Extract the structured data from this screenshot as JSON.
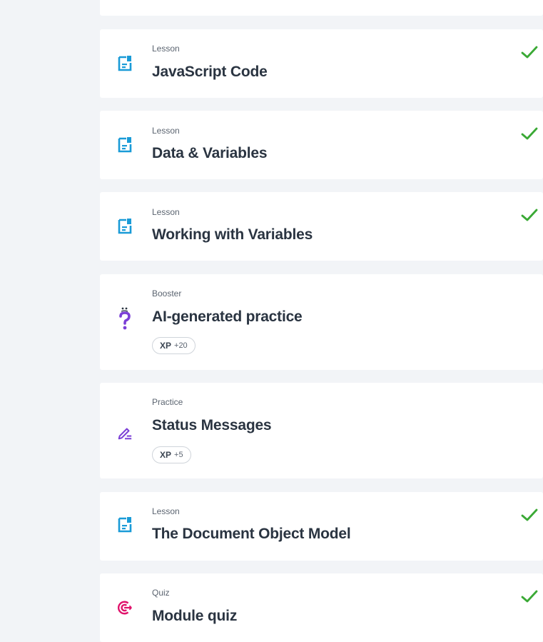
{
  "items": [
    {
      "kind": "Lesson",
      "title": "JavaScript Code",
      "icon": "lesson-document-icon",
      "completed": true
    },
    {
      "kind": "Lesson",
      "title": "Data & Variables",
      "icon": "lesson-document-icon",
      "completed": true
    },
    {
      "kind": "Lesson",
      "title": "Working with Variables",
      "icon": "lesson-document-icon",
      "completed": true
    },
    {
      "kind": "Booster",
      "title": "AI-generated practice",
      "icon": "question-mark-icon",
      "completed": false,
      "xp_label": "XP",
      "xp_value": "+20"
    },
    {
      "kind": "Practice",
      "title": "Status Messages",
      "icon": "pencil-edit-icon",
      "completed": false,
      "xp_label": "XP",
      "xp_value": "+5"
    },
    {
      "kind": "Lesson",
      "title": "The Document Object Model",
      "icon": "lesson-document-icon",
      "completed": true
    },
    {
      "kind": "Quiz",
      "title": "Module quiz",
      "icon": "target-icon",
      "completed": true
    }
  ],
  "colors": {
    "background": "#f2f4f7",
    "card": "#ffffff",
    "lesson_icon": "#1a9bd7",
    "booster_icon": "#7b3fd6",
    "practice_icon": "#7b3fd6",
    "quiz_icon": "#e0126b",
    "check": "#3aa935",
    "title": "#2a3441"
  }
}
